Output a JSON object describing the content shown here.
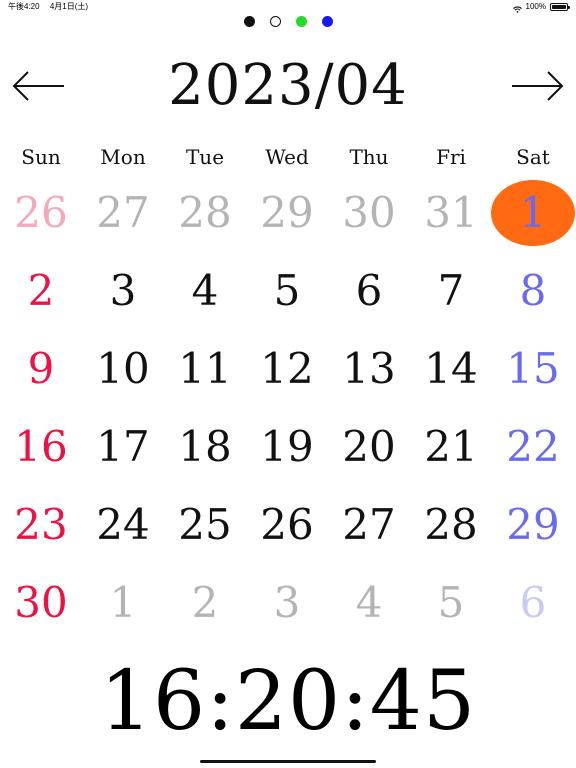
{
  "status_bar": {
    "time": "午後4:20",
    "date": "4月1日(土)",
    "battery": "100%",
    "battery_level": 1.0
  },
  "page_indicator": {
    "dots": [
      {
        "style": "filled",
        "color": "#111111"
      },
      {
        "style": "outline",
        "color": "#111111"
      },
      {
        "style": "filled",
        "color": "#22dd22"
      },
      {
        "style": "filled",
        "color": "#1a1aee"
      }
    ],
    "active_index": 1
  },
  "navigation": {
    "prev_icon": "left-arrow-icon",
    "next_icon": "right-arrow-icon"
  },
  "calendar": {
    "title": "2023/04",
    "weekdays": [
      "Sun",
      "Mon",
      "Tue",
      "Wed",
      "Thu",
      "Fri",
      "Sat"
    ],
    "weeks": [
      [
        {
          "label": "26",
          "tone": "sunday-outside"
        },
        {
          "label": "27",
          "tone": "outside"
        },
        {
          "label": "28",
          "tone": "outside"
        },
        {
          "label": "29",
          "tone": "outside"
        },
        {
          "label": "30",
          "tone": "outside"
        },
        {
          "label": "31",
          "tone": "outside"
        },
        {
          "label": "1",
          "tone": "today"
        }
      ],
      [
        {
          "label": "2",
          "tone": "sunday"
        },
        {
          "label": "3",
          "tone": "weekday"
        },
        {
          "label": "4",
          "tone": "weekday"
        },
        {
          "label": "5",
          "tone": "weekday"
        },
        {
          "label": "6",
          "tone": "weekday"
        },
        {
          "label": "7",
          "tone": "weekday"
        },
        {
          "label": "8",
          "tone": "saturday"
        }
      ],
      [
        {
          "label": "9",
          "tone": "sunday"
        },
        {
          "label": "10",
          "tone": "weekday"
        },
        {
          "label": "11",
          "tone": "weekday"
        },
        {
          "label": "12",
          "tone": "weekday"
        },
        {
          "label": "13",
          "tone": "weekday"
        },
        {
          "label": "14",
          "tone": "weekday"
        },
        {
          "label": "15",
          "tone": "saturday"
        }
      ],
      [
        {
          "label": "16",
          "tone": "sunday"
        },
        {
          "label": "17",
          "tone": "weekday"
        },
        {
          "label": "18",
          "tone": "weekday"
        },
        {
          "label": "19",
          "tone": "weekday"
        },
        {
          "label": "20",
          "tone": "weekday"
        },
        {
          "label": "21",
          "tone": "weekday"
        },
        {
          "label": "22",
          "tone": "saturday"
        }
      ],
      [
        {
          "label": "23",
          "tone": "sunday"
        },
        {
          "label": "24",
          "tone": "weekday"
        },
        {
          "label": "25",
          "tone": "weekday"
        },
        {
          "label": "26",
          "tone": "weekday"
        },
        {
          "label": "27",
          "tone": "weekday"
        },
        {
          "label": "28",
          "tone": "weekday"
        },
        {
          "label": "29",
          "tone": "saturday"
        }
      ],
      [
        {
          "label": "30",
          "tone": "sunday"
        },
        {
          "label": "1",
          "tone": "outside"
        },
        {
          "label": "2",
          "tone": "outside"
        },
        {
          "label": "3",
          "tone": "outside"
        },
        {
          "label": "4",
          "tone": "outside"
        },
        {
          "label": "5",
          "tone": "outside"
        },
        {
          "label": "6",
          "tone": "saturday-outside"
        }
      ]
    ]
  },
  "clock": {
    "time": "16:20:45"
  },
  "colors": {
    "weekday": "#111111",
    "sunday": "#ee1144",
    "saturday": "#6a6aee",
    "outside": "#b4b4b4",
    "sunday_outside": "#f4a8bc",
    "saturday_outside": "#c9c9f4",
    "today_text": "#6a6aee",
    "today_highlight": "#ff6a13"
  }
}
